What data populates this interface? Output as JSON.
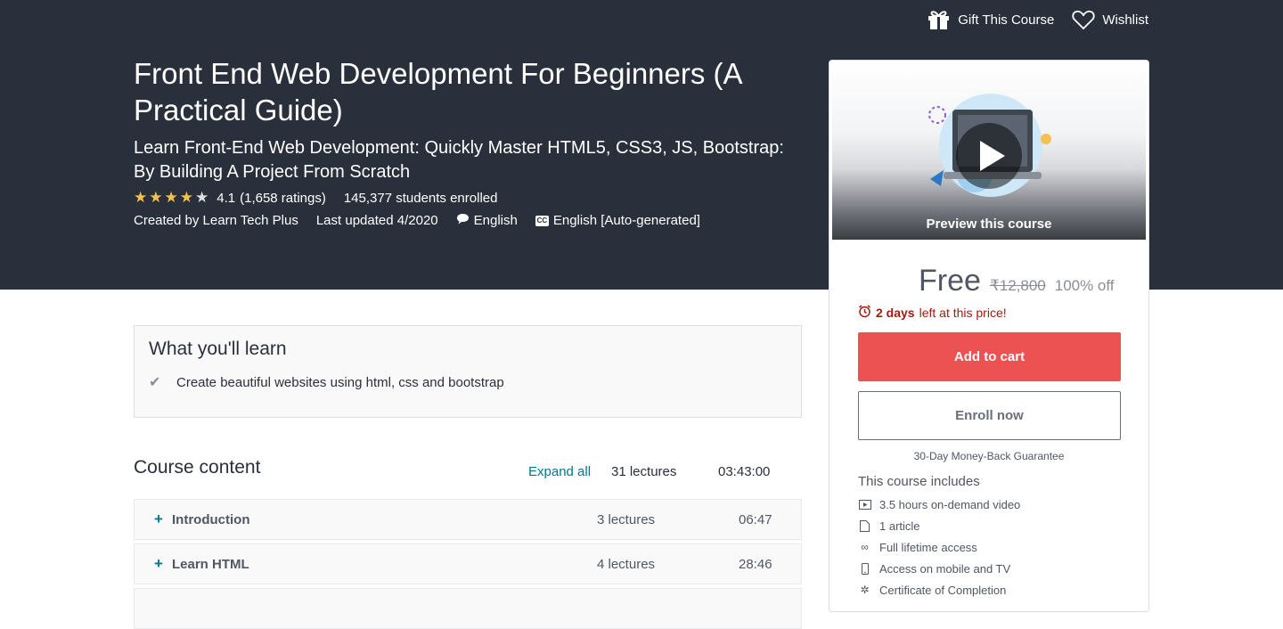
{
  "header": {
    "gift_label": "Gift This Course",
    "wishlist_label": "Wishlist"
  },
  "course": {
    "title": "Front End Web Development For Beginners (A Practical Guide)",
    "subtitle": "Learn Front-End Web Development: Quickly Master HTML5, CSS3, JS, Bootstrap: By Building A Project From Scratch",
    "rating": 4.1,
    "rating_display": "4.1",
    "ratings_count": "(1,658 ratings)",
    "students": "145,377 students enrolled",
    "created_by": "Created by Learn Tech Plus",
    "last_updated": "Last updated 4/2020",
    "language": "English",
    "captions": "English [Auto-generated]"
  },
  "sidebar": {
    "preview_label": "Preview this course",
    "price": "Free",
    "original_price": "₹12,800",
    "discount": "100% off",
    "deadline_bold": "2 days",
    "deadline_rest": "left at this price!",
    "add_to_cart": "Add to cart",
    "enroll_now": "Enroll now",
    "guarantee": "30-Day Money-Back Guarantee",
    "includes_title": "This course includes",
    "includes": [
      {
        "icon": "video-icon",
        "label": "3.5 hours on-demand video"
      },
      {
        "icon": "article-icon",
        "label": "1 article"
      },
      {
        "icon": "infinity-icon",
        "label": "Full lifetime access"
      },
      {
        "icon": "mobile-icon",
        "label": "Access on mobile and TV"
      },
      {
        "icon": "certificate-icon",
        "label": "Certificate of Completion"
      }
    ]
  },
  "learn": {
    "title": "What you'll learn",
    "items": [
      "Create beautiful websites using html, css and bootstrap"
    ]
  },
  "content": {
    "title": "Course content",
    "expand_all": "Expand all",
    "total_lectures": "31 lectures",
    "total_time": "03:43:00",
    "sections": [
      {
        "name": "Introduction",
        "lectures": "3 lectures",
        "time": "06:47"
      },
      {
        "name": "Learn HTML",
        "lectures": "4 lectures",
        "time": "28:46"
      }
    ]
  },
  "colors": {
    "hero_bg": "#29303b",
    "star": "#f4c150",
    "cart_button": "#ec5252",
    "link": "#007791",
    "deadline": "#a31a12"
  }
}
